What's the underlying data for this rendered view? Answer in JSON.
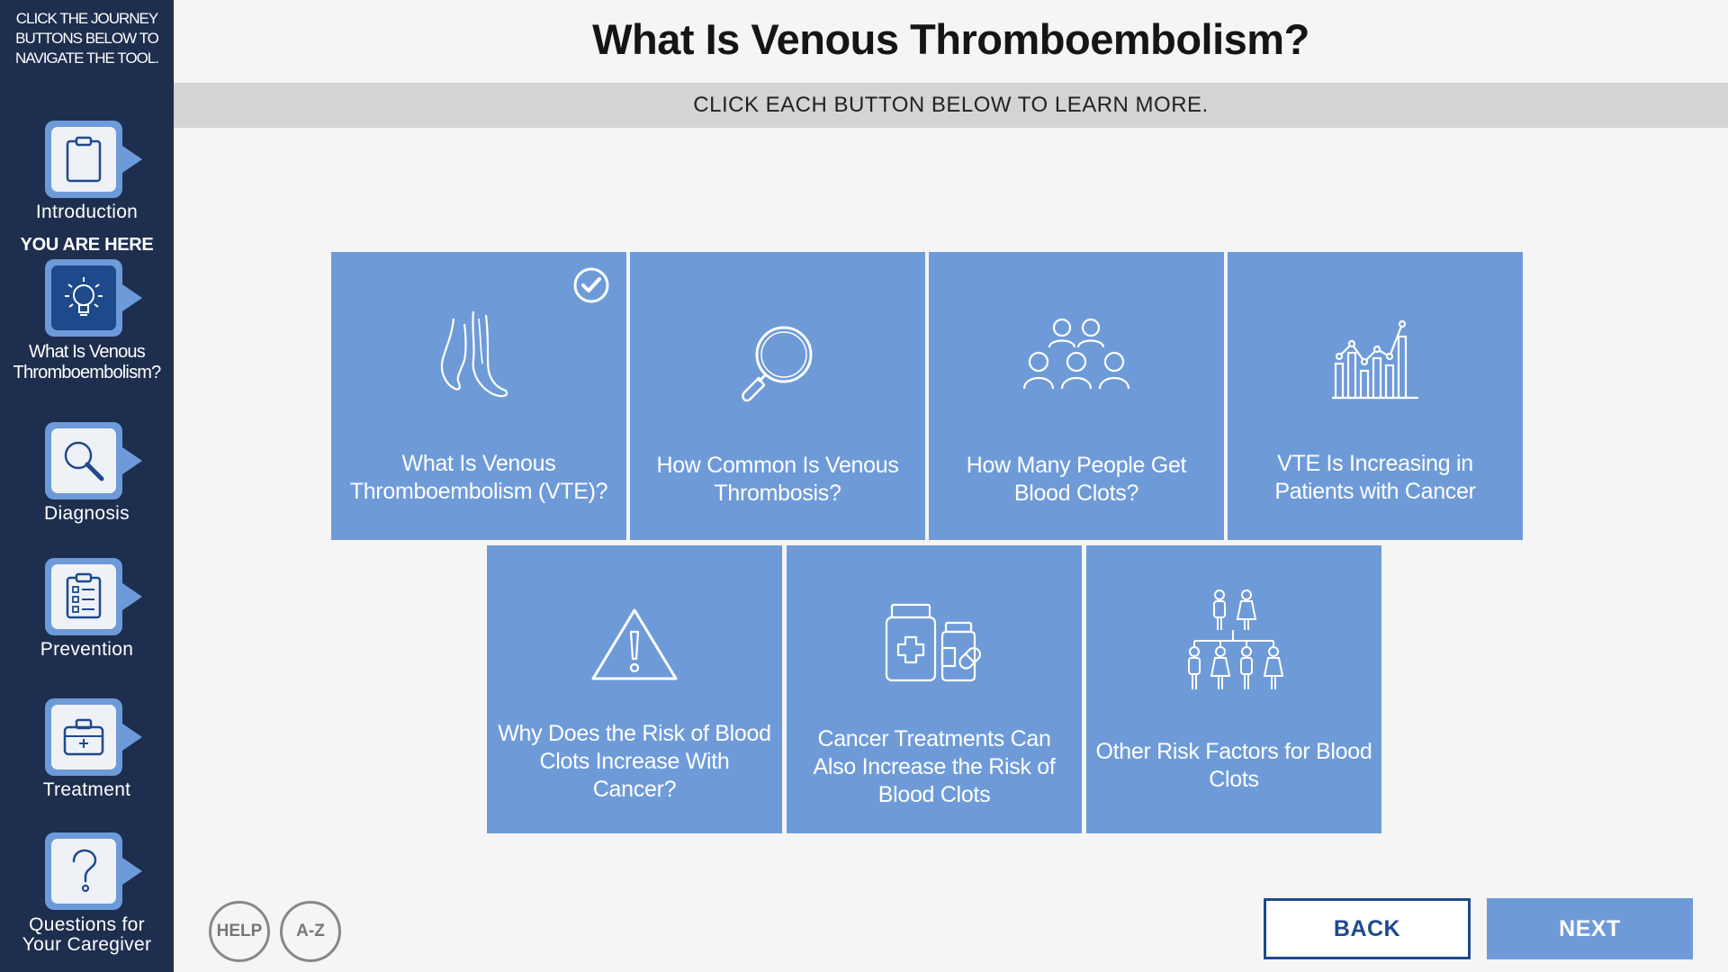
{
  "sidebar": {
    "instructions": "CLICK THE JOURNEY BUTTONS BELOW TO NAVIGATE THE TOOL.",
    "you_are_here": "YOU ARE HERE",
    "items": [
      {
        "label": "Introduction",
        "icon": "clipboard-icon",
        "active": false
      },
      {
        "label": "What Is Venous Thromboembolism?",
        "icon": "lightbulb-icon",
        "active": true
      },
      {
        "label": "Diagnosis",
        "icon": "magnifier-icon",
        "active": false
      },
      {
        "label": "Prevention",
        "icon": "checklist-icon",
        "active": false
      },
      {
        "label": "Treatment",
        "icon": "medical-kit-icon",
        "active": false
      },
      {
        "label": "Questions for Your Caregiver",
        "icon": "question-mark-icon",
        "active": false
      }
    ]
  },
  "header": {
    "title": "What Is Venous Thromboembolism?",
    "instruction": "CLICK EACH BUTTON BELOW TO LEARN MORE."
  },
  "cards": [
    {
      "label": "What Is Venous Thromboembolism (VTE)?",
      "icon": "legs-icon",
      "completed": true
    },
    {
      "label": "How Common Is Venous Thrombosis?",
      "icon": "magnifying-glass-icon",
      "completed": false
    },
    {
      "label": "How Many People Get Blood Clots?",
      "icon": "people-group-icon",
      "completed": false
    },
    {
      "label": "VTE Is Increasing in Patients with Cancer",
      "icon": "bar-chart-icon",
      "completed": false
    },
    {
      "label": "Why Does the Risk of Blood Clots Increase With Cancer?",
      "icon": "warning-triangle-icon",
      "completed": false
    },
    {
      "label": "Cancer Treatments Can Also Increase the Risk of Blood Clots",
      "icon": "medicine-bottles-icon",
      "completed": false
    },
    {
      "label": "Other Risk Factors for Blood Clots",
      "icon": "family-tree-icon",
      "completed": false
    }
  ],
  "footer": {
    "help_label": "HELP",
    "az_label": "A-Z",
    "back_label": "BACK",
    "next_label": "NEXT"
  },
  "colors": {
    "sidebar_bg": "#1e2e4e",
    "card_bg": "#6e9bd8",
    "accent_dark": "#1e4a8c",
    "instruction_bar": "#d4d4d4"
  }
}
